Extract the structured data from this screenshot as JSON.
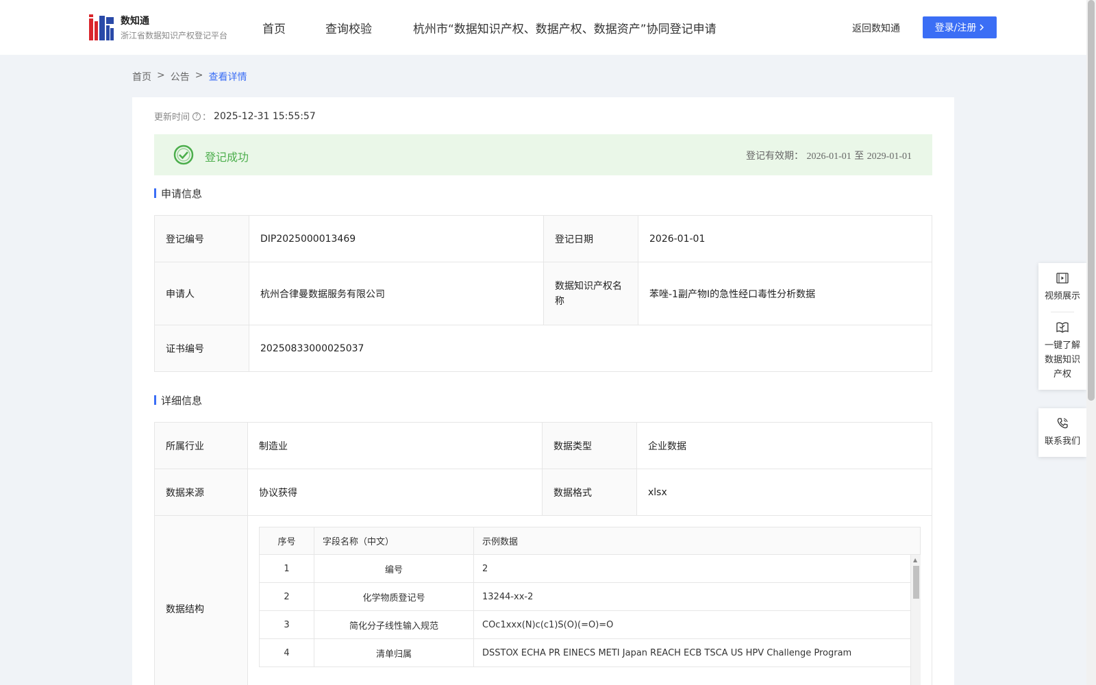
{
  "header": {
    "logo_title": "数知通",
    "logo_subtitle": "浙江省数据知识产权登记平台",
    "nav": [
      "首页",
      "查询校验",
      "杭州市“数据知识产权、数据产权、数据资产”协同登记申请"
    ],
    "back_link": "返回数知通",
    "login_button": "登录/注册"
  },
  "breadcrumb": {
    "home": "首页",
    "sep": ">",
    "section": "公告",
    "current": "查看详情"
  },
  "update": {
    "label": "更新时间",
    "help": "?",
    "colon": "：",
    "value": "2025-12-31 15:55:57"
  },
  "status": {
    "text": "登记成功",
    "validity_label": "登记有效期：",
    "validity_from": "2026-01-01",
    "validity_to_word": "至",
    "validity_to": "2029-01-01",
    "color": "#4cae4c"
  },
  "application": {
    "title": "申请信息",
    "reg_no_label": "登记编号",
    "reg_no": "DIP2025000013469",
    "reg_date_label": "登记日期",
    "reg_date": "2026-01-01",
    "applicant_label": "申请人",
    "applicant": "杭州合律曼数据服务有限公司",
    "ip_name_label": "数据知识产权名称",
    "ip_name": "苯唑-1副产物Ⅰ的急性经口毒性分析数据",
    "cert_label": "证书编号",
    "cert_no": "20250833000025037"
  },
  "detail": {
    "title": "详细信息",
    "industry_label": "所属行业",
    "industry": "制造业",
    "data_type_label": "数据类型",
    "data_type": "企业数据",
    "source_label": "数据来源",
    "source": "协议获得",
    "format_label": "数据格式",
    "format": "xlsx",
    "structure_label": "数据结构",
    "structure": {
      "headers": [
        "序号",
        "字段名称（中文）",
        "示例数据"
      ],
      "rows": [
        [
          "1",
          "编号",
          "2"
        ],
        [
          "2",
          "化学物质登记号",
          "13244-xx-2"
        ],
        [
          "3",
          "简化分子线性输入规范",
          "COc1xxx(N)c(c1)S(O)(=O)=O"
        ],
        [
          "4",
          "清单归属",
          "DSSTOX ECHA PR EINECS METI Japan REACH ECB TSCA US HPV Challenge Program"
        ]
      ]
    }
  },
  "float_panel": {
    "video": "视频展示",
    "learn_line1": "一键了解",
    "learn_line2": "数据知识",
    "learn_line3": "产权",
    "contact": "联系我们"
  },
  "colors": {
    "accent": "#3b6ef5",
    "success_bg": "#eaf7e8",
    "page_bg": "#f0f3f7"
  }
}
